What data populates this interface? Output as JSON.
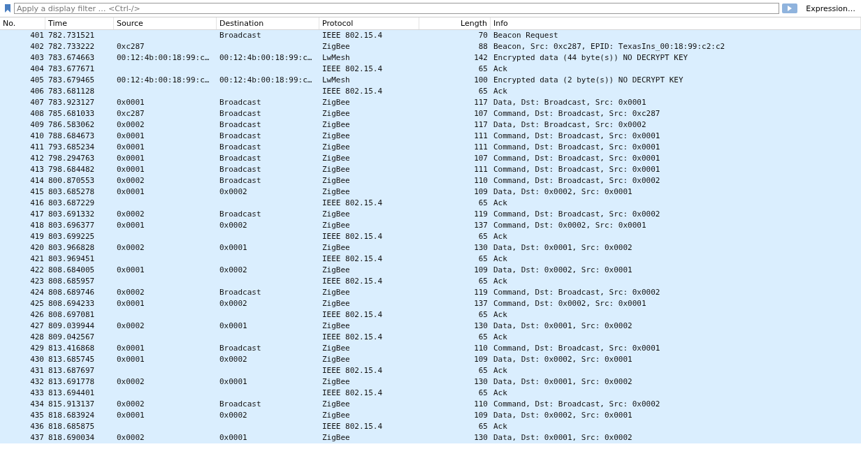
{
  "filter_bar": {
    "placeholder": "Apply a display filter … <Ctrl-/>",
    "expression_button": "Expression…"
  },
  "table": {
    "columns": [
      "No.",
      "Time",
      "Source",
      "Destination",
      "Protocol",
      "Length",
      "Info"
    ],
    "rows": [
      {
        "no": "401",
        "time": "782.731521",
        "destination": "Broadcast",
        "protocol": "IEEE 802.15.4",
        "length": "70",
        "info": "Beacon Request"
      },
      {
        "no": "402",
        "time": "782.733222",
        "source": "0xc287",
        "protocol": "ZigBee",
        "length": "88",
        "info": "Beacon, Src: 0xc287, EPID: TexasIns_00:18:99:c2:c2"
      },
      {
        "no": "403",
        "time": "783.674663",
        "source": "00:12:4b:00:18:99:c…",
        "destination": "00:12:4b:00:18:99:c…",
        "protocol": "LwMesh",
        "length": "142",
        "info": "Encrypted data (44 byte(s)) NO DECRYPT KEY"
      },
      {
        "no": "404",
        "time": "783.677671",
        "protocol": "IEEE 802.15.4",
        "length": "65",
        "info": "Ack"
      },
      {
        "no": "405",
        "time": "783.679465",
        "source": "00:12:4b:00:18:99:c…",
        "destination": "00:12:4b:00:18:99:c…",
        "protocol": "LwMesh",
        "length": "100",
        "info": "Encrypted data (2 byte(s)) NO DECRYPT KEY"
      },
      {
        "no": "406",
        "time": "783.681128",
        "protocol": "IEEE 802.15.4",
        "length": "65",
        "info": "Ack"
      },
      {
        "no": "407",
        "time": "783.923127",
        "source": "0x0001",
        "destination": "Broadcast",
        "protocol": "ZigBee",
        "length": "117",
        "info": "Data, Dst: Broadcast, Src: 0x0001"
      },
      {
        "no": "408",
        "time": "785.681033",
        "source": "0xc287",
        "destination": "Broadcast",
        "protocol": "ZigBee",
        "length": "107",
        "info": "Command, Dst: Broadcast, Src: 0xc287"
      },
      {
        "no": "409",
        "time": "786.583062",
        "source": "0x0002",
        "destination": "Broadcast",
        "protocol": "ZigBee",
        "length": "117",
        "info": "Data, Dst: Broadcast, Src: 0x0002"
      },
      {
        "no": "410",
        "time": "788.684673",
        "source": "0x0001",
        "destination": "Broadcast",
        "protocol": "ZigBee",
        "length": "111",
        "info": "Command, Dst: Broadcast, Src: 0x0001"
      },
      {
        "no": "411",
        "time": "793.685234",
        "source": "0x0001",
        "destination": "Broadcast",
        "protocol": "ZigBee",
        "length": "111",
        "info": "Command, Dst: Broadcast, Src: 0x0001"
      },
      {
        "no": "412",
        "time": "798.294763",
        "source": "0x0001",
        "destination": "Broadcast",
        "protocol": "ZigBee",
        "length": "107",
        "info": "Command, Dst: Broadcast, Src: 0x0001"
      },
      {
        "no": "413",
        "time": "798.684482",
        "source": "0x0001",
        "destination": "Broadcast",
        "protocol": "ZigBee",
        "length": "111",
        "info": "Command, Dst: Broadcast, Src: 0x0001"
      },
      {
        "no": "414",
        "time": "800.870553",
        "source": "0x0002",
        "destination": "Broadcast",
        "protocol": "ZigBee",
        "length": "110",
        "info": "Command, Dst: Broadcast, Src: 0x0002"
      },
      {
        "no": "415",
        "time": "803.685278",
        "source": "0x0001",
        "destination": "0x0002",
        "protocol": "ZigBee",
        "length": "109",
        "info": "Data, Dst: 0x0002, Src: 0x0001"
      },
      {
        "no": "416",
        "time": "803.687229",
        "protocol": "IEEE 802.15.4",
        "length": "65",
        "info": "Ack"
      },
      {
        "no": "417",
        "time": "803.691332",
        "source": "0x0002",
        "destination": "Broadcast",
        "protocol": "ZigBee",
        "length": "119",
        "info": "Command, Dst: Broadcast, Src: 0x0002"
      },
      {
        "no": "418",
        "time": "803.696377",
        "source": "0x0001",
        "destination": "0x0002",
        "protocol": "ZigBee",
        "length": "137",
        "info": "Command, Dst: 0x0002, Src: 0x0001"
      },
      {
        "no": "419",
        "time": "803.699225",
        "protocol": "IEEE 802.15.4",
        "length": "65",
        "info": "Ack"
      },
      {
        "no": "420",
        "time": "803.966828",
        "source": "0x0002",
        "destination": "0x0001",
        "protocol": "ZigBee",
        "length": "130",
        "info": "Data, Dst: 0x0001, Src: 0x0002"
      },
      {
        "no": "421",
        "time": "803.969451",
        "protocol": "IEEE 802.15.4",
        "length": "65",
        "info": "Ack"
      },
      {
        "no": "422",
        "time": "808.684005",
        "source": "0x0001",
        "destination": "0x0002",
        "protocol": "ZigBee",
        "length": "109",
        "info": "Data, Dst: 0x0002, Src: 0x0001"
      },
      {
        "no": "423",
        "time": "808.685957",
        "protocol": "IEEE 802.15.4",
        "length": "65",
        "info": "Ack"
      },
      {
        "no": "424",
        "time": "808.689746",
        "source": "0x0002",
        "destination": "Broadcast",
        "protocol": "ZigBee",
        "length": "119",
        "info": "Command, Dst: Broadcast, Src: 0x0002"
      },
      {
        "no": "425",
        "time": "808.694233",
        "source": "0x0001",
        "destination": "0x0002",
        "protocol": "ZigBee",
        "length": "137",
        "info": "Command, Dst: 0x0002, Src: 0x0001"
      },
      {
        "no": "426",
        "time": "808.697081",
        "protocol": "IEEE 802.15.4",
        "length": "65",
        "info": "Ack"
      },
      {
        "no": "427",
        "time": "809.039944",
        "source": "0x0002",
        "destination": "0x0001",
        "protocol": "ZigBee",
        "length": "130",
        "info": "Data, Dst: 0x0001, Src: 0x0002"
      },
      {
        "no": "428",
        "time": "809.042567",
        "protocol": "IEEE 802.15.4",
        "length": "65",
        "info": "Ack"
      },
      {
        "no": "429",
        "time": "813.416868",
        "source": "0x0001",
        "destination": "Broadcast",
        "protocol": "ZigBee",
        "length": "110",
        "info": "Command, Dst: Broadcast, Src: 0x0001"
      },
      {
        "no": "430",
        "time": "813.685745",
        "source": "0x0001",
        "destination": "0x0002",
        "protocol": "ZigBee",
        "length": "109",
        "info": "Data, Dst: 0x0002, Src: 0x0001"
      },
      {
        "no": "431",
        "time": "813.687697",
        "protocol": "IEEE 802.15.4",
        "length": "65",
        "info": "Ack"
      },
      {
        "no": "432",
        "time": "813.691778",
        "source": "0x0002",
        "destination": "0x0001",
        "protocol": "ZigBee",
        "length": "130",
        "info": "Data, Dst: 0x0001, Src: 0x0002"
      },
      {
        "no": "433",
        "time": "813.694401",
        "protocol": "IEEE 802.15.4",
        "length": "65",
        "info": "Ack"
      },
      {
        "no": "434",
        "time": "815.913137",
        "source": "0x0002",
        "destination": "Broadcast",
        "protocol": "ZigBee",
        "length": "110",
        "info": "Command, Dst: Broadcast, Src: 0x0002"
      },
      {
        "no": "435",
        "time": "818.683924",
        "source": "0x0001",
        "destination": "0x0002",
        "protocol": "ZigBee",
        "length": "109",
        "info": "Data, Dst: 0x0002, Src: 0x0001"
      },
      {
        "no": "436",
        "time": "818.685875",
        "protocol": "IEEE 802.15.4",
        "length": "65",
        "info": "Ack"
      },
      {
        "no": "437",
        "time": "818.690034",
        "source": "0x0002",
        "destination": "0x0001",
        "protocol": "ZigBee",
        "length": "130",
        "info": "Data, Dst: 0x0001, Src: 0x0002"
      }
    ]
  }
}
